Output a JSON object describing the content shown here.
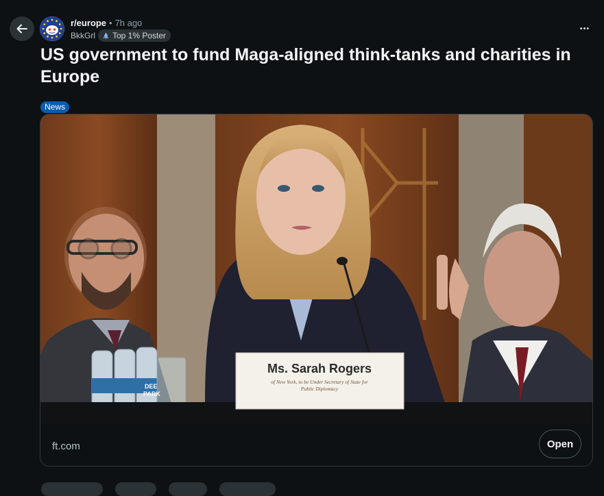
{
  "header": {
    "back_icon": "arrow-left-icon",
    "subreddit": "r/europe",
    "separator": "•",
    "time_ago": "7h ago",
    "author": "BkkGrl",
    "author_flair": "Top 1% Poster",
    "author_flair_icon": "rocket-icon",
    "more_icon": "ellipsis-icon",
    "more_label": "•••"
  },
  "post": {
    "title": "US government to fund Maga-aligned think-tanks and charities in Europe",
    "flair": "News",
    "flair_color": "#0a5cb0"
  },
  "link_card": {
    "image_nameplate_name": "Ms. Sarah Rogers",
    "image_nameplate_line1": "of New York, to be Under Secretary of State for",
    "image_nameplate_line2": "Public Diplomacy",
    "image_bottle_label1": "DEE",
    "image_bottle_label2": "PARK",
    "domain": "ft.com",
    "open_label": "Open"
  },
  "colors": {
    "background": "#0e1113",
    "button_bg": "#2a3236",
    "muted_text": "#8ba2ad",
    "card_border": "#2f3a3f"
  }
}
